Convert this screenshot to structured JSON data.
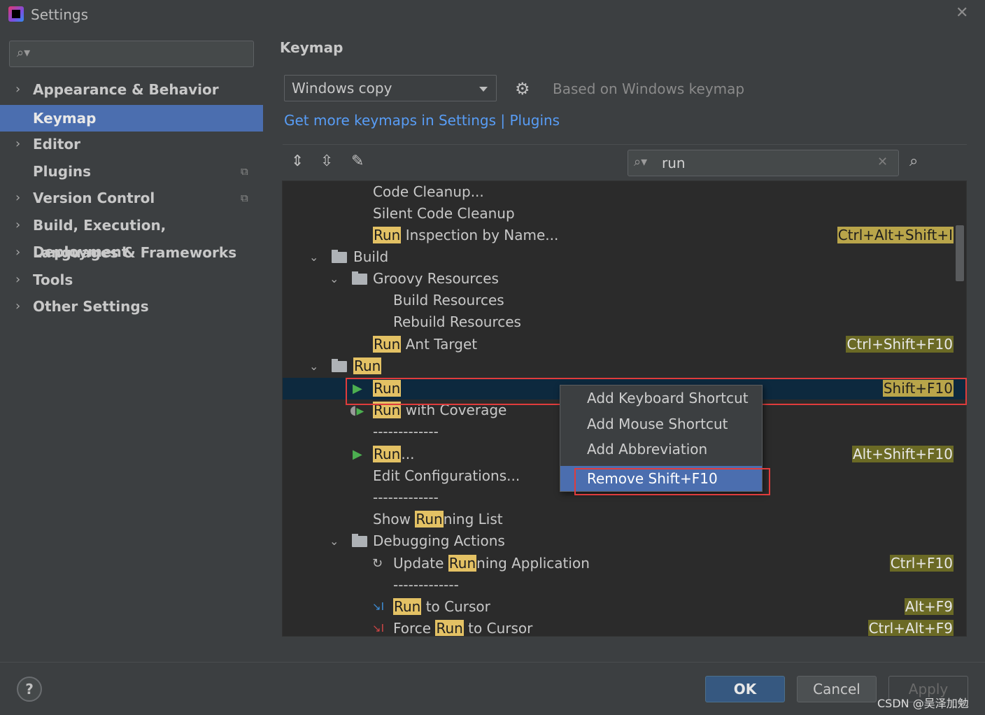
{
  "window": {
    "title": "Settings"
  },
  "sidebar": {
    "search_placeholder": "",
    "items": [
      {
        "label": "Appearance & Behavior",
        "expandable": true
      },
      {
        "label": "Keymap",
        "selected": true
      },
      {
        "label": "Editor",
        "expandable": true
      },
      {
        "label": "Plugins"
      },
      {
        "label": "Version Control",
        "expandable": true
      },
      {
        "label": "Build, Execution, Deployment",
        "expandable": true
      },
      {
        "label": "Languages & Frameworks",
        "expandable": true
      },
      {
        "label": "Tools",
        "expandable": true
      },
      {
        "label": "Other Settings",
        "expandable": true
      }
    ]
  },
  "keymap": {
    "title": "Keymap",
    "selected": "Windows copy",
    "based_on": "Based on Windows keymap",
    "link": "Get more keymaps in Settings | Plugins",
    "search_value": "run"
  },
  "tree": {
    "rows": [
      {
        "pre": "",
        "hl": "",
        "post": "Code Cleanup...",
        "shortcut": ""
      },
      {
        "pre": "",
        "hl": "",
        "post": "Silent Code Cleanup",
        "shortcut": ""
      },
      {
        "pre": "",
        "hl": "Run",
        "post": " Inspection by Name...",
        "shortcut": "Ctrl+Alt+Shift+I"
      },
      {
        "pre": "",
        "hl": "",
        "post": "Build",
        "shortcut": ""
      },
      {
        "pre": "",
        "hl": "",
        "post": "Groovy Resources",
        "shortcut": ""
      },
      {
        "pre": "",
        "hl": "",
        "post": "Build Resources",
        "shortcut": ""
      },
      {
        "pre": "",
        "hl": "",
        "post": "Rebuild Resources",
        "shortcut": ""
      },
      {
        "pre": "",
        "hl": "Run",
        "post": " Ant Target",
        "shortcut": "Ctrl+Shift+F10"
      },
      {
        "pre": "",
        "hl": "Run",
        "post": "",
        "shortcut": ""
      },
      {
        "pre": "",
        "hl": "Run",
        "post": "",
        "shortcut": "Shift+F10"
      },
      {
        "pre": "",
        "hl": "Run",
        "post": " with Coverage",
        "shortcut": ""
      },
      {
        "pre": "",
        "hl": "",
        "post": "-------------",
        "shortcut": ""
      },
      {
        "pre": "",
        "hl": "Run",
        "post": "...",
        "shortcut": "Alt+Shift+F10"
      },
      {
        "pre": "",
        "hl": "",
        "post": "Edit Configurations...",
        "shortcut": ""
      },
      {
        "pre": "",
        "hl": "",
        "post": "-------------",
        "shortcut": ""
      },
      {
        "pre": "Show ",
        "hl": "Run",
        "post": "ning List",
        "shortcut": ""
      },
      {
        "pre": "",
        "hl": "",
        "post": "Debugging Actions",
        "shortcut": ""
      },
      {
        "pre": "Update ",
        "hl": "Run",
        "post": "ning Application",
        "shortcut": "Ctrl+F10"
      },
      {
        "pre": "",
        "hl": "",
        "post": "-------------",
        "shortcut": ""
      },
      {
        "pre": "",
        "hl": "Run",
        "post": " to Cursor",
        "shortcut": "Alt+F9"
      },
      {
        "pre": "Force ",
        "hl": "Run",
        "post": " to Cursor",
        "shortcut": "Ctrl+Alt+F9"
      }
    ]
  },
  "context_menu": {
    "items": [
      "Add Keyboard Shortcut",
      "Add Mouse Shortcut",
      "Add Abbreviation",
      "Remove Shift+F10"
    ],
    "selected": "Remove Shift+F10"
  },
  "buttons": {
    "ok": "OK",
    "cancel": "Cancel",
    "apply": "Apply",
    "help": "?"
  },
  "watermark": "CSDN @吴泽加勉",
  "colors": {
    "selection": "#4b6eaf",
    "highlight": "#e3c164",
    "link": "#589df6",
    "annotation": "#e03c3c"
  }
}
